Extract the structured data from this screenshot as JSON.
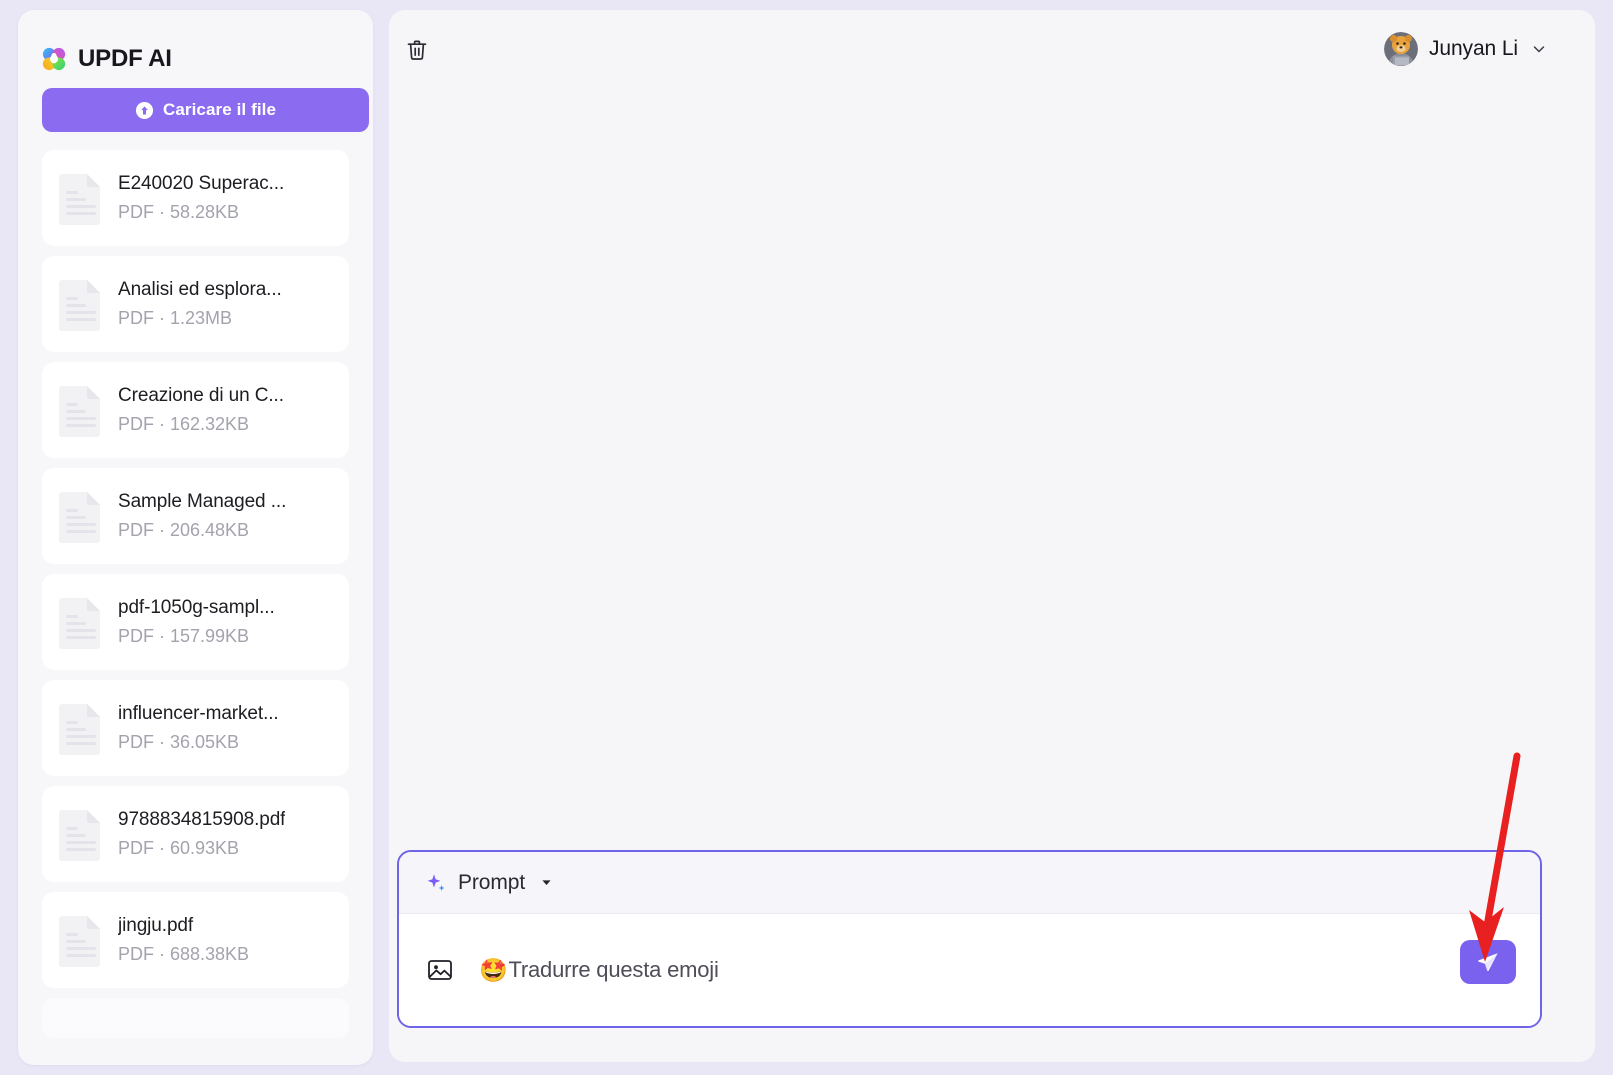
{
  "app": {
    "brand_title": "UPDF AI",
    "logo_icon": "updf-clover-logo"
  },
  "sidebar": {
    "upload_button": {
      "label": "Caricare il file",
      "icon": "upload-arrow-icon",
      "color": "#8b6cf0"
    },
    "files": [
      {
        "name": "E240020 Superac...",
        "meta": "PDF · 58.28KB",
        "icon": "pdf-file-icon"
      },
      {
        "name": "Analisi ed esplora...",
        "meta": "PDF · 1.23MB",
        "icon": "pdf-file-icon"
      },
      {
        "name": "Creazione di un C...",
        "meta": "PDF · 162.32KB",
        "icon": "pdf-file-icon"
      },
      {
        "name": "Sample Managed ...",
        "meta": "PDF · 206.48KB",
        "icon": "pdf-file-icon"
      },
      {
        "name": "pdf-1050g-sampl...",
        "meta": "PDF · 157.99KB",
        "icon": "pdf-file-icon"
      },
      {
        "name": "influencer-market...",
        "meta": "PDF · 36.05KB",
        "icon": "pdf-file-icon"
      },
      {
        "name": "9788834815908.pdf",
        "meta": "PDF · 60.93KB",
        "icon": "pdf-file-icon"
      },
      {
        "name": "jingju.pdf",
        "meta": "PDF · 688.38KB",
        "icon": "pdf-file-icon"
      }
    ]
  },
  "header": {
    "trash_icon": "trash-icon",
    "user_name": "Junyan Li",
    "avatar_icon": "user-avatar",
    "caret_icon": "chevron-down-icon"
  },
  "composer": {
    "prompt_label": "Prompt",
    "spark_icon": "sparkle-icon",
    "caret_icon": "chevron-down-icon",
    "image_icon": "image-icon",
    "input_emoji": "🤩",
    "input_value": "Tradurre questa emoji",
    "send_icon": "send-paper-plane-icon",
    "send_color": "#7a62ef",
    "border_color": "#6f63e8"
  },
  "annotation": {
    "arrow_icon": "red-pointer-arrow",
    "color": "#e8201f"
  }
}
